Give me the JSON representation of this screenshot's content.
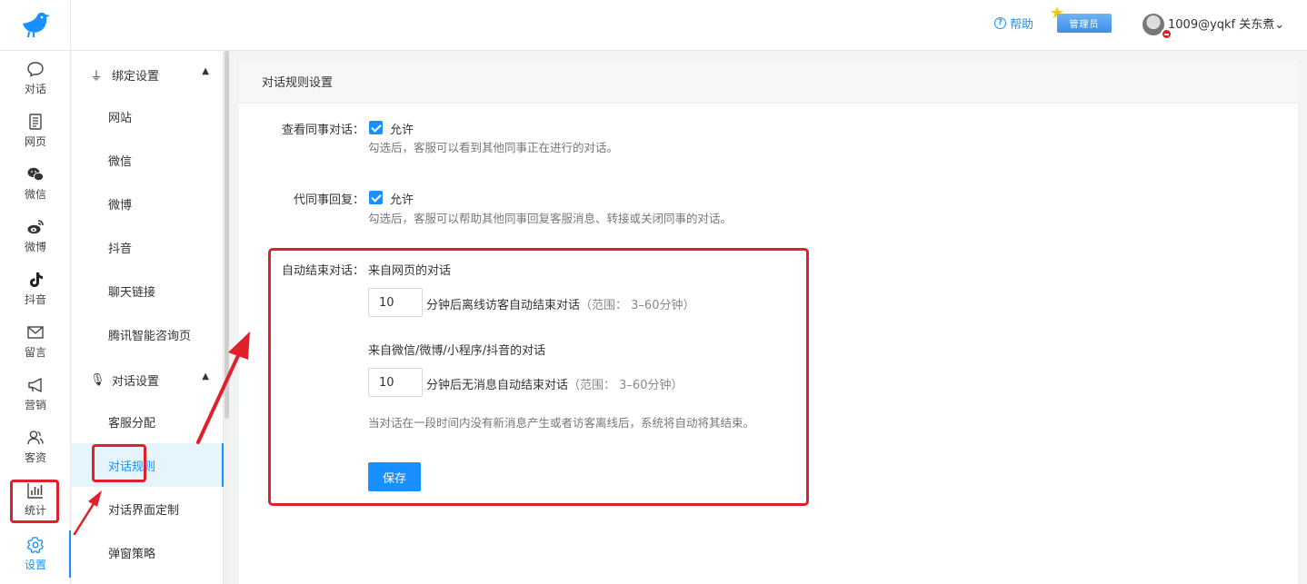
{
  "header": {
    "help_label": "帮助",
    "admin_badge": "管理员",
    "username": "1009@yqkf 关东煮"
  },
  "rail": {
    "items": [
      {
        "label": "对话",
        "icon": "chat-bubble-icon"
      },
      {
        "label": "网页",
        "icon": "webpage-icon"
      },
      {
        "label": "微信",
        "icon": "wechat-icon"
      },
      {
        "label": "微博",
        "icon": "weibo-icon"
      },
      {
        "label": "抖音",
        "icon": "douyin-icon"
      },
      {
        "label": "留言",
        "icon": "mail-icon"
      },
      {
        "label": "营销",
        "icon": "megaphone-icon"
      },
      {
        "label": "客资",
        "icon": "users-icon"
      },
      {
        "label": "统计",
        "icon": "chart-icon"
      },
      {
        "label": "设置",
        "icon": "gear-icon"
      }
    ],
    "active": "设置"
  },
  "submenu": {
    "group1": {
      "label": "绑定设置",
      "icon": "plug-icon"
    },
    "group1_items": [
      "网站",
      "微信",
      "微博",
      "抖音",
      "聊天链接",
      "腾讯智能咨询页"
    ],
    "group2": {
      "label": "对话设置",
      "icon": "microphone-icon"
    },
    "group2_items": [
      "客服分配",
      "对话规则",
      "对话界面定制",
      "弹窗策略"
    ],
    "active": "对话规则"
  },
  "content": {
    "title": "对话规则设置",
    "view_colleague": {
      "label": "查看同事对话：",
      "checked": true,
      "option": "允许",
      "hint": "勾选后，客服可以看到其他同事正在进行的对话。"
    },
    "reply_for_colleague": {
      "label": "代同事回复：",
      "checked": true,
      "option": "允许",
      "hint": "勾选后，客服可以帮助其他同事回复客服消息、转接或关闭同事的对话。"
    },
    "auto_end": {
      "label": "自动结束对话：",
      "web_title": "来自网页的对话",
      "web_minutes": "10",
      "web_desc": "分钟后离线访客自动结束对话",
      "web_range": "（范围： 3–60分钟）",
      "social_title": "来自微信/微博/小程序/抖音的对话",
      "social_minutes": "10",
      "social_desc": "分钟后无消息自动结束对话",
      "social_range": "（范围： 3–60分钟）",
      "hint": "当对话在一段时间内没有新消息产生或者访客离线后，系统将自动将其结束。"
    },
    "save_label": "保存"
  },
  "colors": {
    "accent": "#1890ff",
    "annotation_red": "#e0202a"
  }
}
